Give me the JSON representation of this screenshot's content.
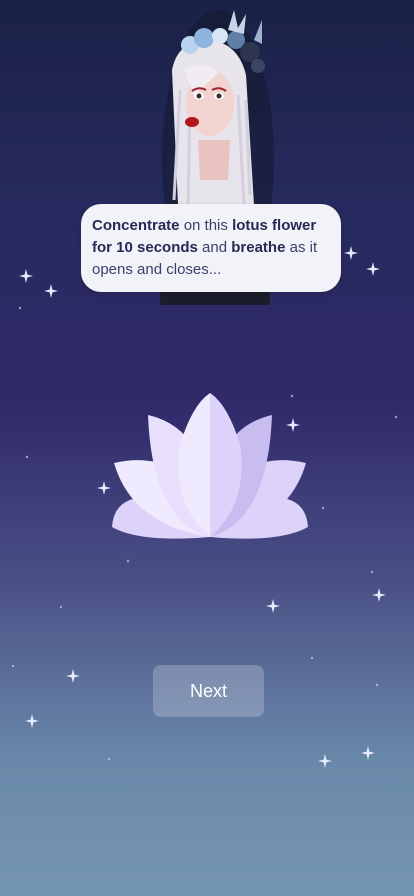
{
  "bubble": {
    "part1": "Concentrate",
    "part2": " on this ",
    "part3": "lotus flower for 10 seconds",
    "part4": " and ",
    "part5": "breathe",
    "part6": " as it opens and closes..."
  },
  "next_button": {
    "label": "Next"
  },
  "colors": {
    "bubble_bg": "#f2f3f8",
    "lotus_light": "#efeafd",
    "lotus_mid": "#ddd2fa",
    "lotus_dark": "#c9bdf0"
  },
  "icons": [
    "sparkle-icon",
    "lotus-flower-icon"
  ]
}
